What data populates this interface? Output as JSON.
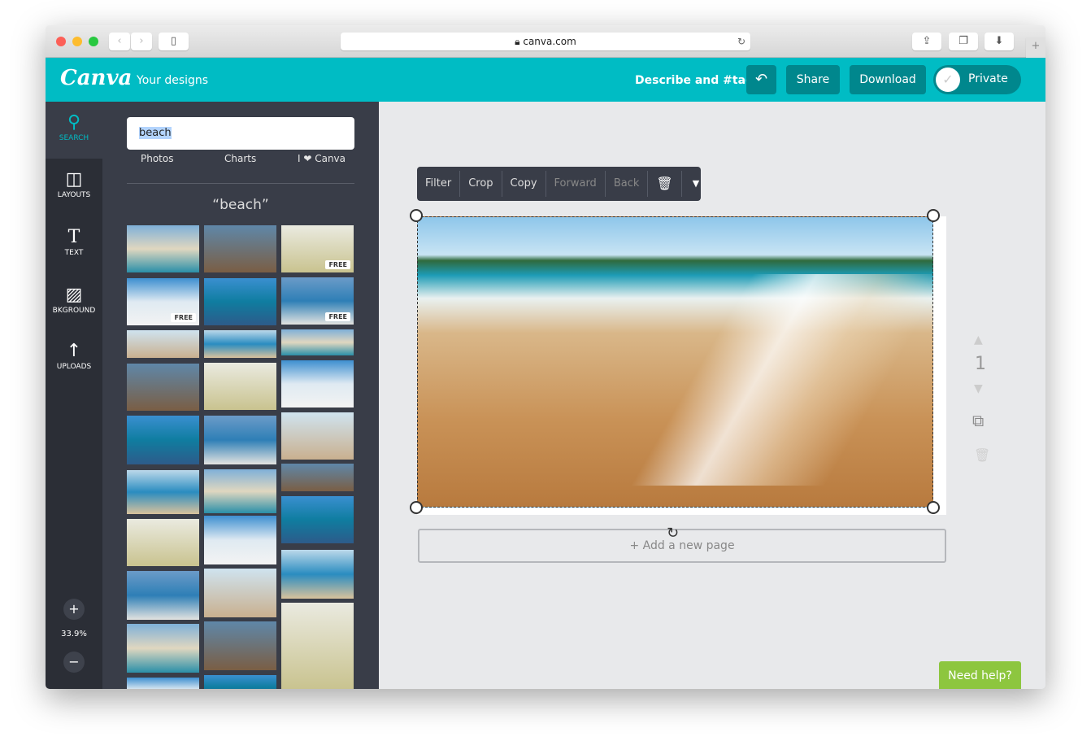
{
  "browser": {
    "url": "canva.com"
  },
  "header": {
    "logo": "Canva",
    "your_designs": "Your designs",
    "describe": "Describe and #tag",
    "share": "Share",
    "download": "Download",
    "privacy": "Private"
  },
  "rail": {
    "items": [
      {
        "label": "SEARCH",
        "icon": "search-icon"
      },
      {
        "label": "LAYOUTS",
        "icon": "layouts-icon"
      },
      {
        "label": "TEXT",
        "icon": "text-icon"
      },
      {
        "label": "BKGROUND",
        "icon": "background-icon"
      },
      {
        "label": "UPLOADS",
        "icon": "upload-icon"
      }
    ],
    "zoom": "33.9%",
    "zoom_in": "+",
    "zoom_out": "−"
  },
  "panel": {
    "search_value": "beach",
    "categories": [
      "Photos",
      "Charts",
      "I ❤ Canva"
    ],
    "results_title": "“beach”",
    "free_label": "FREE"
  },
  "toolbar": {
    "filter": "Filter",
    "crop": "Crop",
    "copy": "Copy",
    "forward": "Forward",
    "back": "Back"
  },
  "canvas": {
    "add_page": "+ Add a new page",
    "page_number": "1",
    "help": "Need help?"
  },
  "colors": {
    "brand": "#00bcc4",
    "button": "#00878d",
    "help": "#8dc63f"
  }
}
